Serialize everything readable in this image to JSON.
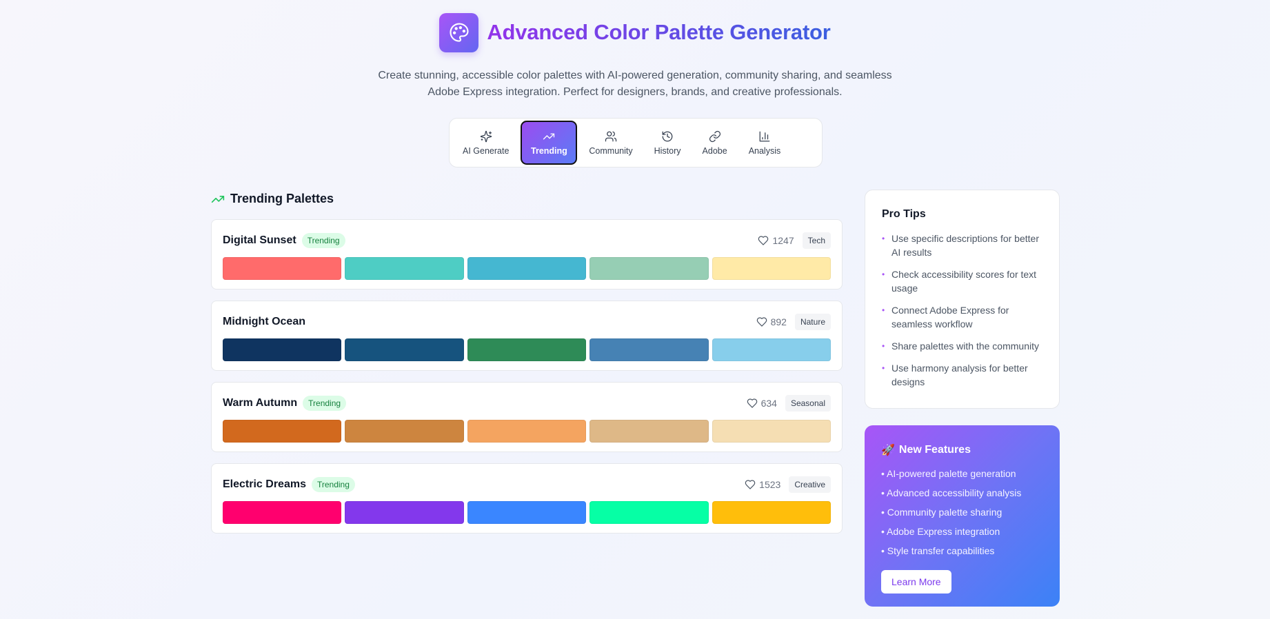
{
  "header": {
    "title": "Advanced Color Palette Generator",
    "subtitle": "Create stunning, accessible color palettes with AI-powered generation, community sharing, and seamless Adobe Express integration. Perfect for designers, brands, and creative professionals."
  },
  "tabs": [
    {
      "label": "AI Generate",
      "icon": "sparkles-icon",
      "active": false
    },
    {
      "label": "Trending",
      "icon": "trending-up-icon",
      "active": true
    },
    {
      "label": "Community",
      "icon": "users-icon",
      "active": false
    },
    {
      "label": "History",
      "icon": "history-icon",
      "active": false
    },
    {
      "label": "Adobe",
      "icon": "link-icon",
      "active": false
    },
    {
      "label": "Analysis",
      "icon": "bar-chart-icon",
      "active": false
    }
  ],
  "section": {
    "title": "Trending Palettes"
  },
  "palettes": [
    {
      "name": "Digital Sunset",
      "badge": "Trending",
      "likes": "1247",
      "tag": "Tech",
      "colors": [
        "#FF6B6B",
        "#4ECDC4",
        "#45B7D1",
        "#96CEB4",
        "#FFEAA7"
      ]
    },
    {
      "name": "Midnight Ocean",
      "badge": "",
      "likes": "892",
      "tag": "Nature",
      "colors": [
        "#0F3460",
        "#16537E",
        "#2E8B57",
        "#4682B4",
        "#87CEEB"
      ]
    },
    {
      "name": "Warm Autumn",
      "badge": "Trending",
      "likes": "634",
      "tag": "Seasonal",
      "colors": [
        "#D2691E",
        "#CD853F",
        "#F4A460",
        "#DEB887",
        "#F5DEB3"
      ]
    },
    {
      "name": "Electric Dreams",
      "badge": "Trending",
      "likes": "1523",
      "tag": "Creative",
      "colors": [
        "#FF006E",
        "#8338EC",
        "#3A86FF",
        "#06FFA5",
        "#FFBE0B"
      ]
    }
  ],
  "tips": {
    "title": "Pro Tips",
    "items": [
      "Use specific descriptions for better AI results",
      "Check accessibility scores for text usage",
      "Connect Adobe Express for seamless workflow",
      "Share palettes with the community",
      "Use harmony analysis for better designs"
    ]
  },
  "features": {
    "emoji": "🚀",
    "title": "New Features",
    "items": [
      "• AI-powered palette generation",
      "• Advanced accessibility analysis",
      "• Community palette sharing",
      "• Adobe Express integration",
      "• Style transfer capabilities"
    ],
    "button": "Learn More"
  },
  "colors": {
    "accent": "#9333ea",
    "trending_icon": "#22c55e"
  }
}
